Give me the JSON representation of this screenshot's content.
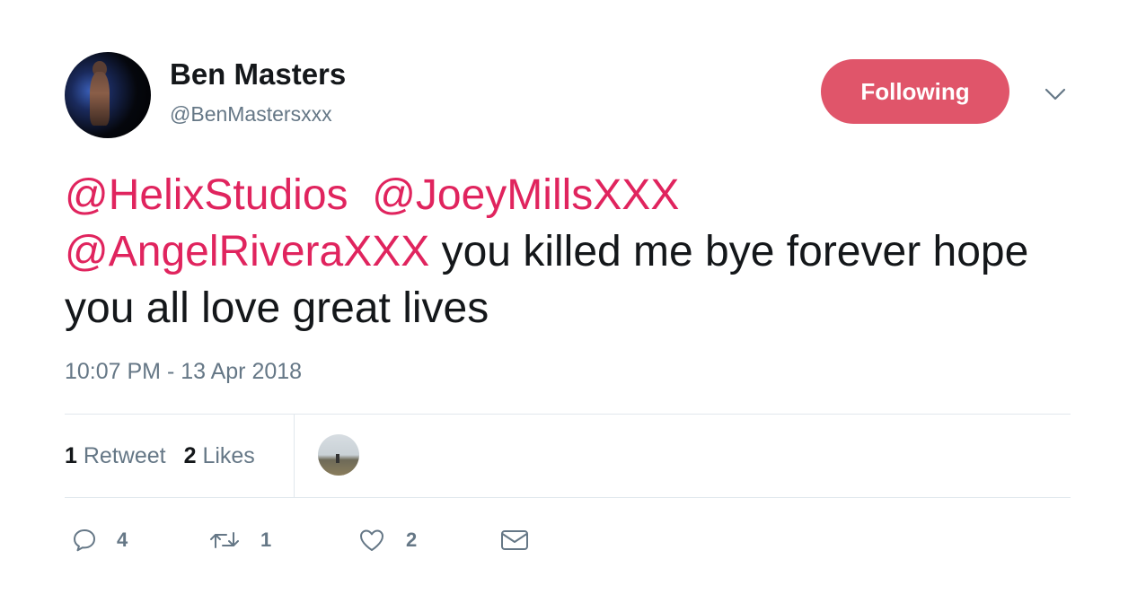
{
  "author": {
    "name": "Ben Masters",
    "handle": "@BenMastersxxx"
  },
  "follow_button": {
    "label": "Following",
    "color": "#e0556a"
  },
  "tweet": {
    "mention_1": "@HelixStudios",
    "mention_2": "@JoeyMillsXXX",
    "mention_3": "@AngelRiveraXXX",
    "text": "you killed me bye forever hope you all love great lives"
  },
  "timestamp": "10:07 PM - 13 Apr 2018",
  "stats": {
    "retweets_count": "1",
    "retweets_label": "Retweet",
    "likes_count": "2",
    "likes_label": "Likes"
  },
  "actions": {
    "reply_count": "4",
    "retweet_count": "1",
    "like_count": "2"
  },
  "icons": [
    "chevron-down-icon",
    "reply-icon",
    "retweet-icon",
    "heart-icon",
    "mail-icon"
  ],
  "colors": {
    "mention": "#e0245e",
    "secondary_text": "#657786"
  }
}
